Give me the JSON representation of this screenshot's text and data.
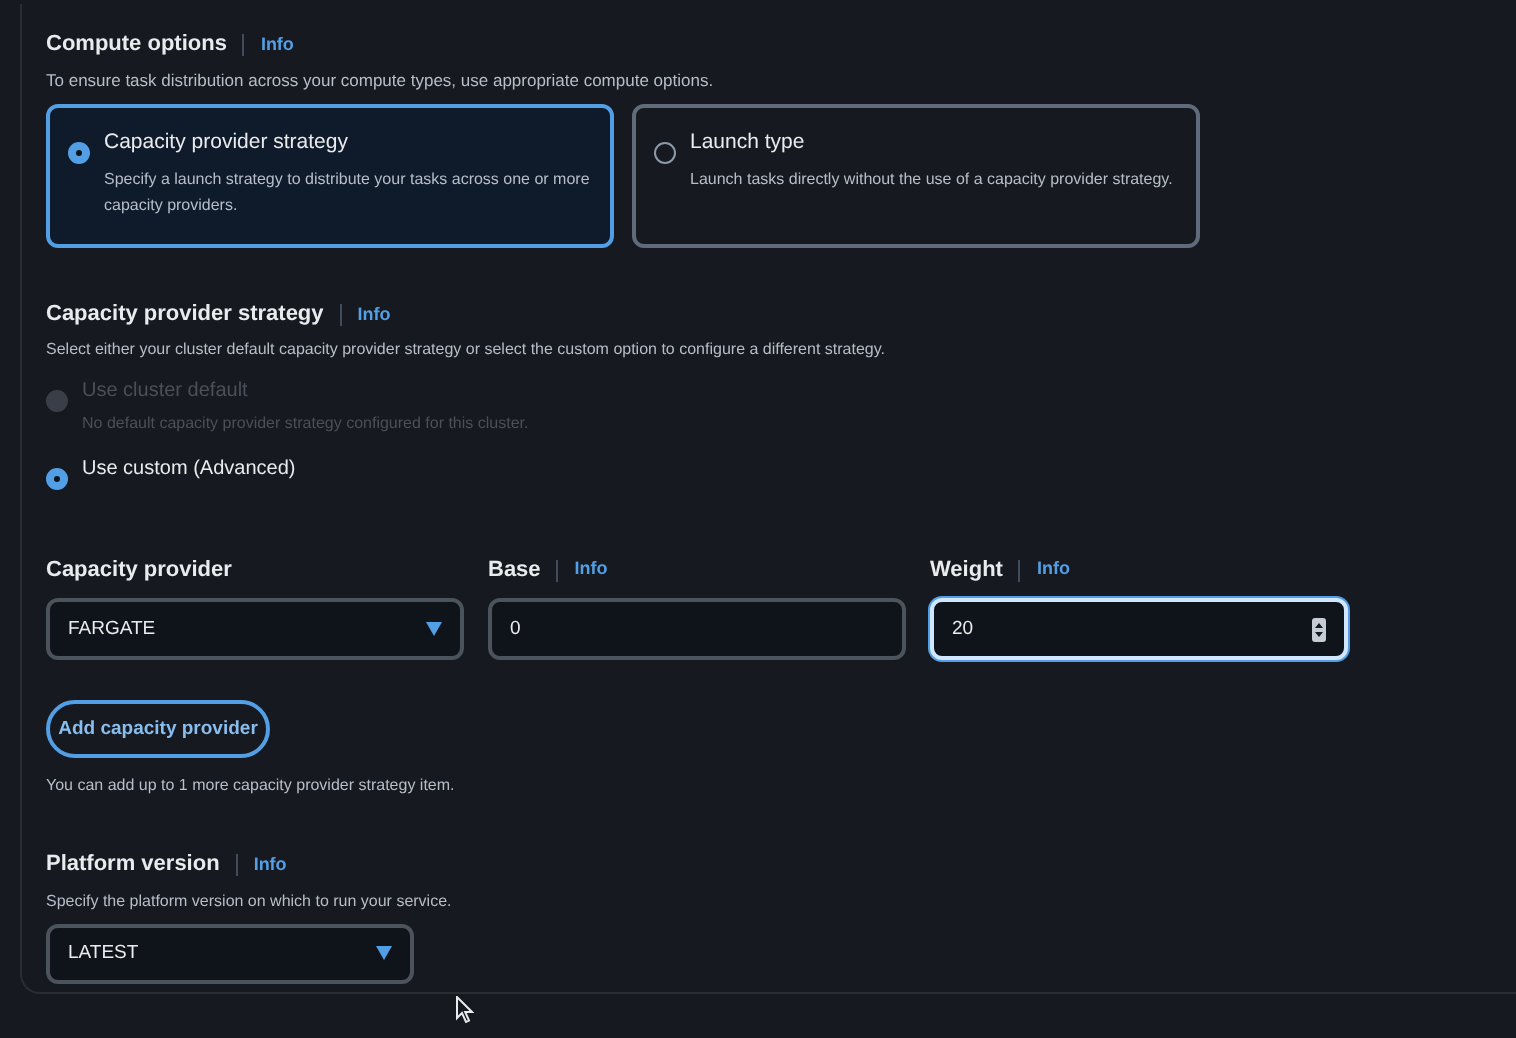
{
  "compute_options": {
    "title": "Compute options",
    "info": "Info",
    "description": "To ensure task distribution across your compute types, use appropriate compute options.",
    "cards": [
      {
        "title": "Capacity provider strategy",
        "description": "Specify a launch strategy to distribute your tasks across one or more capacity providers.",
        "selected": true
      },
      {
        "title": "Launch type",
        "description": "Launch tasks directly without the use of a capacity provider strategy.",
        "selected": false
      }
    ]
  },
  "strategy": {
    "title": "Capacity provider strategy",
    "info": "Info",
    "description": "Select either your cluster default capacity provider strategy or select the custom option to configure a different strategy.",
    "options": [
      {
        "label": "Use cluster default",
        "description": "No default capacity provider strategy configured for this cluster.",
        "selected": false,
        "disabled": true
      },
      {
        "label": "Use custom (Advanced)",
        "selected": true,
        "disabled": false
      }
    ]
  },
  "fields": [
    {
      "kind": "select",
      "label": "Capacity provider",
      "value": "FARGATE",
      "focused": false
    },
    {
      "kind": "text",
      "label": "Base",
      "info": "Info",
      "value": "0",
      "focused": false
    },
    {
      "kind": "number",
      "label": "Weight",
      "info": "Info",
      "value": "20",
      "focused": true
    }
  ],
  "add_button": "Add capacity provider",
  "add_hint": "You can add up to 1 more capacity provider strategy item.",
  "platform": {
    "title": "Platform version",
    "info": "Info",
    "description": "Specify the platform version on which to run your service.",
    "value": "LATEST"
  }
}
